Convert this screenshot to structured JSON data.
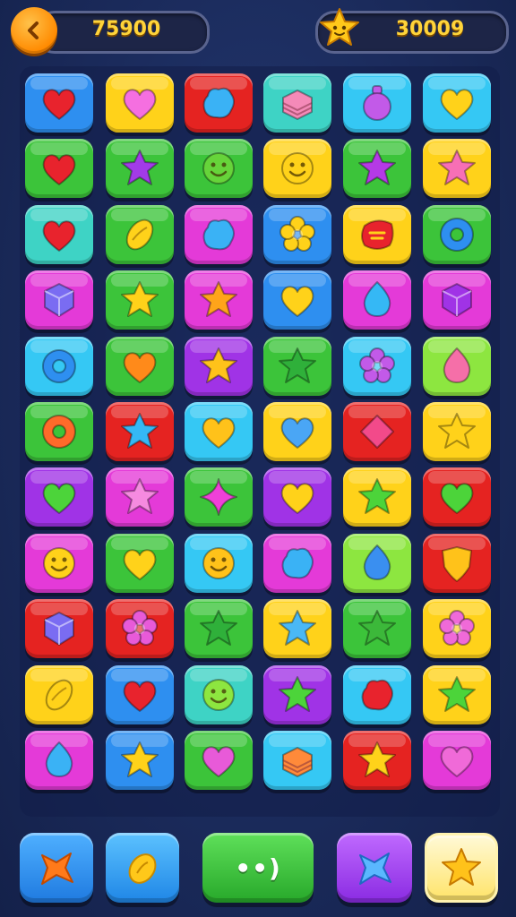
{
  "header": {
    "score": "75900",
    "stars": "30009"
  },
  "colors": {
    "blue": "#2e8ff0",
    "yellow": "#ffd21a",
    "red": "#e52321",
    "teal": "#3ed3c5",
    "cyan": "#35c8f4",
    "green": "#3cc43a",
    "magenta": "#e43ad8",
    "purple": "#a033e6",
    "lime": "#8de640"
  },
  "board": {
    "rows": [
      [
        {
          "color": "blue",
          "icon": "heart",
          "icolor": "#e8232d"
        },
        {
          "color": "yellow",
          "icon": "heart",
          "icolor": "#f56fe0"
        },
        {
          "color": "red",
          "icon": "blob",
          "icolor": "#3ab2f5"
        },
        {
          "color": "teal",
          "icon": "cake",
          "icolor": "#f48ab8"
        },
        {
          "color": "cyan",
          "icon": "potion",
          "icolor": "#c25ae8"
        },
        {
          "color": "cyan",
          "icon": "heart",
          "icolor": "#ffd21a"
        }
      ],
      [
        {
          "color": "green",
          "icon": "heart",
          "icolor": "#e8232d"
        },
        {
          "color": "green",
          "icon": "star",
          "icolor": "#a23be8"
        },
        {
          "color": "green",
          "icon": "smiley",
          "icolor": "#66d43a"
        },
        {
          "color": "yellow",
          "icon": "smiley",
          "icolor": "#ffd21a"
        },
        {
          "color": "green",
          "icon": "star",
          "icolor": "#b53ae6"
        },
        {
          "color": "yellow",
          "icon": "star",
          "icolor": "#f76fb5"
        }
      ],
      [
        {
          "color": "teal",
          "icon": "heart",
          "icolor": "#e8232d"
        },
        {
          "color": "green",
          "icon": "lemon",
          "icolor": "#ffd21a"
        },
        {
          "color": "magenta",
          "icon": "blob",
          "icolor": "#3ab2f5"
        },
        {
          "color": "blue",
          "icon": "flower",
          "icolor": "#ffd21a"
        },
        {
          "color": "yellow",
          "icon": "candy",
          "icolor": "#e8232d"
        },
        {
          "color": "green",
          "icon": "donut",
          "icolor": "#2e8ff0"
        }
      ],
      [
        {
          "color": "magenta",
          "icon": "cube",
          "icolor": "#7a6cf2"
        },
        {
          "color": "green",
          "icon": "star",
          "icolor": "#ffd21a"
        },
        {
          "color": "magenta",
          "icon": "star",
          "icolor": "#ffa41a"
        },
        {
          "color": "blue",
          "icon": "heart",
          "icolor": "#ffd21a"
        },
        {
          "color": "magenta",
          "icon": "drop",
          "icolor": "#35b8f5"
        },
        {
          "color": "magenta",
          "icon": "cube",
          "icolor": "#a033e6"
        }
      ],
      [
        {
          "color": "cyan",
          "icon": "donut",
          "icolor": "#2e8ff0"
        },
        {
          "color": "green",
          "icon": "heart",
          "icolor": "#ff8a1a"
        },
        {
          "color": "purple",
          "icon": "star",
          "icolor": "#ffc21a"
        },
        {
          "color": "green",
          "icon": "star",
          "icolor": "#2fb03a"
        },
        {
          "color": "cyan",
          "icon": "flower",
          "icolor": "#c25ae8"
        },
        {
          "color": "lime",
          "icon": "drop",
          "icolor": "#f56fa8"
        }
      ],
      [
        {
          "color": "green",
          "icon": "donut",
          "icolor": "#ff6a2a"
        },
        {
          "color": "red",
          "icon": "star",
          "icolor": "#35b8f5"
        },
        {
          "color": "cyan",
          "icon": "heart",
          "icolor": "#ffc21a"
        },
        {
          "color": "yellow",
          "icon": "heart",
          "icolor": "#4aa6f5"
        },
        {
          "color": "red",
          "icon": "diamond",
          "icolor": "#f24a8a"
        },
        {
          "color": "yellow",
          "icon": "star",
          "icolor": "#ffd21a"
        }
      ],
      [
        {
          "color": "purple",
          "icon": "heart",
          "icolor": "#4cd43a"
        },
        {
          "color": "magenta",
          "icon": "star",
          "icolor": "#f58ae0"
        },
        {
          "color": "green",
          "icon": "sparkle",
          "icolor": "#f040d8"
        },
        {
          "color": "purple",
          "icon": "heart",
          "icolor": "#ffd21a"
        },
        {
          "color": "yellow",
          "icon": "star",
          "icolor": "#4cd43a"
        },
        {
          "color": "red",
          "icon": "heart",
          "icolor": "#4cd43a"
        }
      ],
      [
        {
          "color": "magenta",
          "icon": "smiley",
          "icolor": "#ffd21a"
        },
        {
          "color": "green",
          "icon": "heart",
          "icolor": "#ffd21a"
        },
        {
          "color": "cyan",
          "icon": "smiley",
          "icolor": "#ffc21a"
        },
        {
          "color": "magenta",
          "icon": "blob",
          "icolor": "#3ab2f5"
        },
        {
          "color": "lime",
          "icon": "drop",
          "icolor": "#3a8ff0"
        },
        {
          "color": "red",
          "icon": "shield",
          "icolor": "#ffc21a"
        }
      ],
      [
        {
          "color": "red",
          "icon": "cube",
          "icolor": "#7a6cf2"
        },
        {
          "color": "red",
          "icon": "flower",
          "icolor": "#e85ad8"
        },
        {
          "color": "green",
          "icon": "star",
          "icolor": "#2fb03a"
        },
        {
          "color": "yellow",
          "icon": "star",
          "icolor": "#4ab8f5"
        },
        {
          "color": "green",
          "icon": "star",
          "icolor": "#3cb83a"
        },
        {
          "color": "yellow",
          "icon": "flower",
          "icolor": "#f06ad8"
        }
      ],
      [
        {
          "color": "yellow",
          "icon": "lemon",
          "icolor": "#ffd21a"
        },
        {
          "color": "blue",
          "icon": "heart",
          "icolor": "#e8232d"
        },
        {
          "color": "teal",
          "icon": "smiley",
          "icolor": "#8de640"
        },
        {
          "color": "purple",
          "icon": "star",
          "icolor": "#4cd43a"
        },
        {
          "color": "cyan",
          "icon": "blob",
          "icolor": "#e8232d"
        },
        {
          "color": "yellow",
          "icon": "star",
          "icolor": "#4cd43a"
        }
      ],
      [
        {
          "color": "magenta",
          "icon": "drop",
          "icolor": "#3ab2f5"
        },
        {
          "color": "blue",
          "icon": "star",
          "icolor": "#ffd21a"
        },
        {
          "color": "green",
          "icon": "heart",
          "icolor": "#e85ad8"
        },
        {
          "color": "cyan",
          "icon": "cake",
          "icolor": "#ff8a3a"
        },
        {
          "color": "red",
          "icon": "star",
          "icolor": "#ffd21a"
        },
        {
          "color": "magenta",
          "icon": "heart",
          "icolor": "#f06ad8"
        }
      ]
    ]
  },
  "controls": {
    "pause_label": "••)"
  }
}
